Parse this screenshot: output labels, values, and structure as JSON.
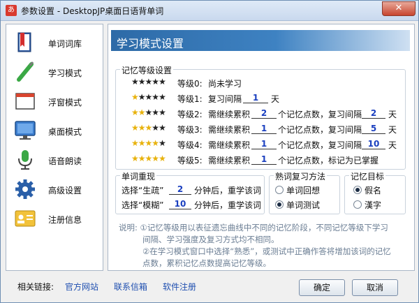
{
  "window": {
    "app_icon_glyph": "あ",
    "title": "参数设置 - DesktopJP桌面日语背单词",
    "close_glyph": "✕"
  },
  "sidebar": {
    "items": [
      {
        "label": "单词词库",
        "icon": "book-icon"
      },
      {
        "label": "学习模式",
        "icon": "brush-icon"
      },
      {
        "label": "浮窗模式",
        "icon": "window-icon"
      },
      {
        "label": "桌面模式",
        "icon": "monitor-icon"
      },
      {
        "label": "语音朗读",
        "icon": "microphone-icon"
      },
      {
        "label": "高级设置",
        "icon": "gear-icon"
      },
      {
        "label": "注册信息",
        "icon": "id-card-icon"
      }
    ]
  },
  "panel": {
    "title": "学习模式设置",
    "memory_levels": {
      "title": "记忆等级设置",
      "rows": [
        {
          "gold_stars": 0,
          "label": "等级0:",
          "text": "尚未学习"
        },
        {
          "gold_stars": 1,
          "label": "等级1:",
          "pre": "复习间隔",
          "value": "1",
          "unit": "天"
        },
        {
          "gold_stars": 2,
          "label": "等级2:",
          "pre": "需继续累积",
          "value": "2",
          "mid": "个记忆点数，复习间隔",
          "value2": "2",
          "unit": "天"
        },
        {
          "gold_stars": 3,
          "label": "等级3:",
          "pre": "需继续累积",
          "value": "1",
          "mid": "个记忆点数，复习间隔",
          "value2": "5",
          "unit": "天"
        },
        {
          "gold_stars": 4,
          "label": "等级4:",
          "pre": "需继续累积",
          "value": "1",
          "mid": "个记忆点数，复习间隔",
          "value2": "10",
          "unit": "天"
        },
        {
          "gold_stars": 5,
          "label": "等级5:",
          "pre": "需继续累积",
          "value": "1",
          "mid": "个记忆点数，标记为已掌握"
        }
      ]
    },
    "word_repeat": {
      "title": "单词重现",
      "line1": {
        "pre": "选择“生疏”",
        "value": "2",
        "post": "分钟后，重学该词"
      },
      "line2": {
        "pre": "选择“模糊”",
        "value": "10",
        "post": "分钟后，重学该词"
      }
    },
    "review_method": {
      "title": "熟词复习方法",
      "options": [
        "单词回想",
        "单词测试"
      ],
      "selected": 1
    },
    "memory_target": {
      "title": "记忆目标",
      "options": [
        "假名",
        "漢字"
      ],
      "selected": 0
    },
    "note": {
      "line1": "说明: ①记忆等级用以表征遗忘曲线中不同的记忆阶段，不同记忆等级下学习",
      "line2": "间隔、学习强度及复习方式均不相同。",
      "line3": "②在学习模式窗口中选择“熟悉”，或测试中正确作答将增加该词的记忆",
      "line4": "点数，累积记忆点数提高记忆等级。"
    }
  },
  "footer": {
    "label": "相关链接:",
    "links": [
      "官方网站",
      "联系信箱",
      "软件注册"
    ],
    "ok_label": "确定",
    "cancel_label": "取消"
  },
  "colors": {
    "header_blue": "#2d6aa7",
    "link_blue": "#1f4fb0",
    "value_blue": "#1a3fbf",
    "star_gold": "#e8b20c"
  }
}
